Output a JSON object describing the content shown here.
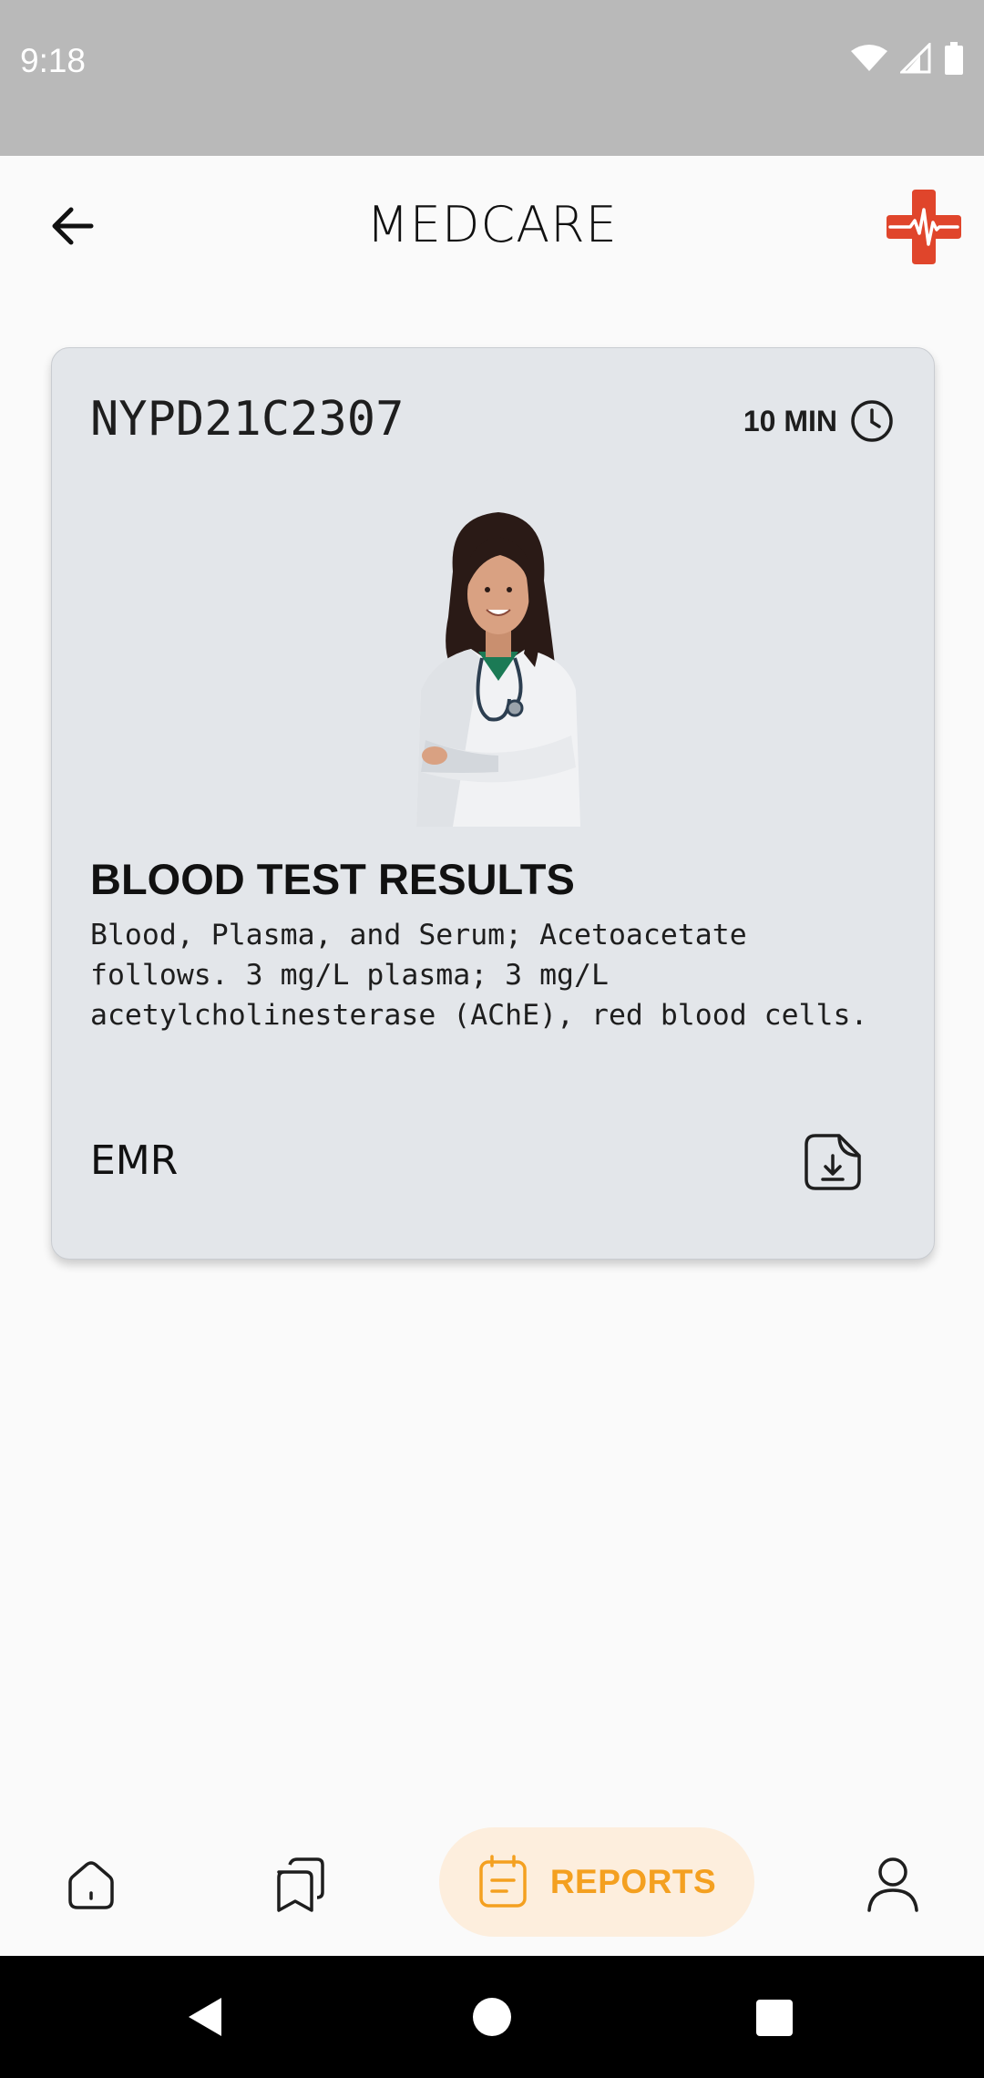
{
  "status_bar": {
    "time": "9:18",
    "icons": [
      "wifi-icon",
      "cellular-signal-icon",
      "battery-icon"
    ]
  },
  "app_bar": {
    "title": "MEDCARE",
    "back_icon": "arrow-left-icon",
    "logo_icon": "medical-cross-heartbeat-icon",
    "accent_color": "#e0452b"
  },
  "report_card": {
    "id": "NYPD21C2307",
    "duration": "10 MIN",
    "duration_icon": "clock-icon",
    "image": "doctor-portrait",
    "title": "BLOOD TEST RESULTS",
    "description": "Blood, Plasma, and Serum; Acetoacetate follows. 3 mg/L plasma; 3 mg/L acetylcholinesterase (AChE), red blood cells.",
    "footer_label": "EMR",
    "action_icon": "download-document-icon",
    "background_color": "#e3e6ea"
  },
  "bottom_nav": {
    "items": [
      {
        "icon": "home-icon",
        "label": ""
      },
      {
        "icon": "cards-icon",
        "label": ""
      },
      {
        "icon": "report-icon",
        "label": "REPORTS",
        "active": true
      },
      {
        "icon": "profile-icon",
        "label": ""
      }
    ],
    "active_color": "#f4a020",
    "active_bg": "#fdeedd"
  },
  "system_nav": {
    "icons": [
      "back-triangle-icon",
      "home-circle-icon",
      "recents-square-icon"
    ]
  }
}
